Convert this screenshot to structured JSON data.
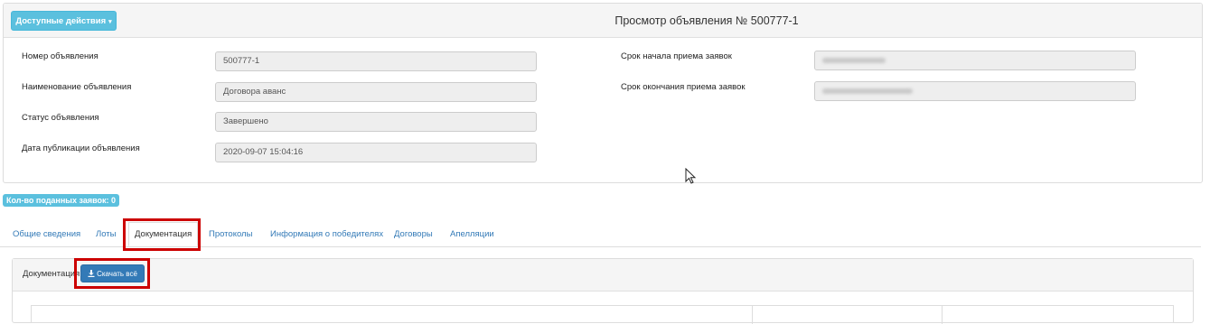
{
  "header": {
    "actions_label": "Доступные действия",
    "caret": "▾",
    "title": "Просмотр объявления № 500777-1"
  },
  "fields": {
    "number_label": "Номер объявления",
    "number_value": "500777-1",
    "name_label": "Наименование объявления",
    "name_value": "Договора аванс",
    "status_label": "Статус объявления",
    "status_value": "Завершено",
    "pubdate_label": "Дата публикации объявления",
    "pubdate_value": "2020-09-07 15:04:16",
    "start_label": "Срок начала приема заявок",
    "end_label": "Срок окончания приема заявок"
  },
  "badge": {
    "count_label": "Кол-во поданных заявок: 0"
  },
  "tabs": [
    {
      "label": "Общие сведения"
    },
    {
      "label": "Лоты"
    },
    {
      "label": "Документация"
    },
    {
      "label": "Протоколы"
    },
    {
      "label": "Информация о победителях"
    },
    {
      "label": "Договоры"
    },
    {
      "label": "Апелляции"
    }
  ],
  "docs": {
    "title": "Документация",
    "download_label": "Скачать всё",
    "download_icon": "download-icon"
  },
  "colors": {
    "info": "#5bc0de",
    "primary": "#337ab7",
    "highlight": "#cc0000"
  }
}
